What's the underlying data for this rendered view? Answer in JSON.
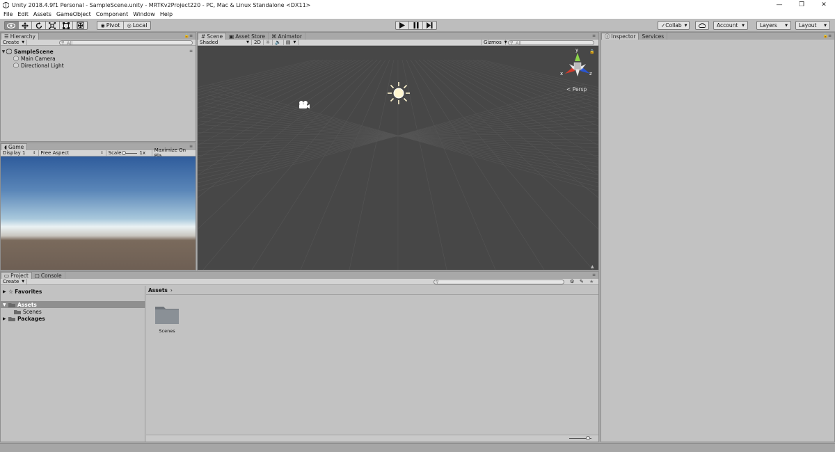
{
  "window": {
    "title": "Unity 2018.4.9f1 Personal - SampleScene.unity - MRTKv2Project220 - PC, Mac & Linux Standalone <DX11>",
    "minimize_glyph": "—",
    "restore_glyph": "❐",
    "close_glyph": "✕"
  },
  "menu": [
    "File",
    "Edit",
    "Assets",
    "GameObject",
    "Component",
    "Window",
    "Help"
  ],
  "toolbar": {
    "pivot_label": "Pivot",
    "local_label": "Local",
    "collab_label": "Collab",
    "account_label": "Account",
    "layers_label": "Layers",
    "layout_label": "Layout",
    "tools": [
      "view-tool-icon",
      "move-tool-icon",
      "rotate-tool-icon",
      "scale-tool-icon",
      "rect-tool-icon",
      "transform-tool-icon"
    ],
    "play_controls": [
      "play-icon",
      "pause-icon",
      "step-icon"
    ]
  },
  "hierarchy": {
    "tab_label": "Hierarchy",
    "create_label": "Create",
    "search_placeholder": "All",
    "scene_name": "SampleScene",
    "objects": [
      "Main Camera",
      "Directional Light"
    ]
  },
  "scene": {
    "tabs": [
      "Scene",
      "Asset Store",
      "Animator"
    ],
    "shading_mode": "Shaded",
    "mode_2d": "2D",
    "gizmos_label": "Gizmos",
    "search_placeholder": "All",
    "projection_label": "Persp",
    "axis_labels": {
      "x": "x",
      "y": "y",
      "z": "z"
    }
  },
  "game": {
    "tab_label": "Game",
    "display": "Display 1",
    "aspect": "Free Aspect",
    "scale_label": "Scale",
    "scale_value": "1x",
    "maximize_label": "Maximize On Pla"
  },
  "inspector": {
    "tabs": [
      "Inspector",
      "Services"
    ]
  },
  "project": {
    "tabs": [
      "Project",
      "Console"
    ],
    "create_label": "Create",
    "tree": {
      "favorites": "Favorites",
      "assets": "Assets",
      "scenes": "Scenes",
      "packages": "Packages"
    },
    "breadcrumb": "Assets",
    "breadcrumb_arrow": "›",
    "items": [
      {
        "name": "Scenes"
      }
    ]
  }
}
